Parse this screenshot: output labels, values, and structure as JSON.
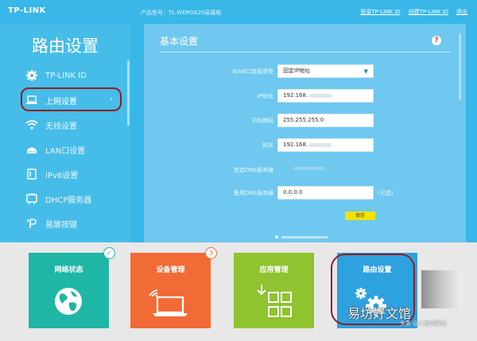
{
  "header": {
    "logo": "TP-LINK",
    "model": "产品型号：TL-WDR5620易展版",
    "links": [
      "登录TP-LINK ID",
      "创建TP-LINK ID",
      "退出"
    ]
  },
  "sidebar": {
    "title": "路由设置",
    "items": [
      {
        "label": "TP-LINK ID",
        "icon": "gear-icon"
      },
      {
        "label": "上网设置",
        "icon": "laptop-icon",
        "chevron": "›"
      },
      {
        "label": "无线设置",
        "icon": "wifi-icon"
      },
      {
        "label": "LAN口设置",
        "icon": "router-icon"
      },
      {
        "label": "IPv6设置",
        "icon": "ipv6-icon"
      },
      {
        "label": "DHCP服务器",
        "icon": "dhcp-icon"
      },
      {
        "label": "易展按键",
        "icon": "button-icon"
      }
    ]
  },
  "main": {
    "title": "基本设置",
    "help": "?",
    "fields": [
      {
        "label": "WAN口连接类型",
        "value": "固定IP地址",
        "caret": "▼"
      },
      {
        "label": "IP地址",
        "value": "192.168."
      },
      {
        "label": "子网掩码",
        "value": "255.255.255.0"
      },
      {
        "label": "网关",
        "value": "192.168."
      },
      {
        "label": "首选DNS服务器",
        "value": ""
      },
      {
        "label": "备用DNS服务器",
        "value": "0.0.0.0",
        "note": "(可选)"
      }
    ],
    "save_label": "保存"
  },
  "tiles": [
    {
      "label": "网络状态",
      "icon": "globe-icon",
      "badge": "✓"
    },
    {
      "label": "设备管理",
      "icon": "laptop-wifi-icon",
      "badge": "3"
    },
    {
      "label": "应用管理",
      "icon": "apps-grid-icon"
    },
    {
      "label": "路由设置",
      "icon": "gears-icon"
    }
  ],
  "watermark": {
    "main": "易坊好文馆",
    "sub": "头条 @人自学装机"
  },
  "colors": {
    "background": "#38b7e8",
    "panel": "#6ec8ef",
    "tile_net": "#1fb6a6",
    "tile_dev": "#f26a35",
    "tile_app": "#8fc32f",
    "tile_route": "#2ea1df",
    "highlight_ring": "#8e1f22",
    "save_button": "#f2e100"
  }
}
